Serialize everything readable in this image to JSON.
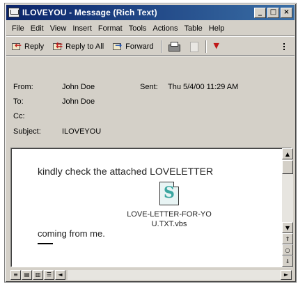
{
  "window": {
    "title": "ILOVEYOU - Message (Rich Text)",
    "minimize_glyph": "_",
    "maximize_glyph": "□",
    "close_glyph": "×"
  },
  "menu": {
    "items": [
      "File",
      "Edit",
      "View",
      "Insert",
      "Format",
      "Tools",
      "Actions",
      "Table",
      "Help"
    ]
  },
  "toolbar": {
    "reply_label": "Reply",
    "reply_all_label": "Reply to All",
    "forward_label": "Forward",
    "icons": [
      "reply-icon",
      "reply-all-icon",
      "forward-icon",
      "print-icon",
      "move-icon",
      "flag-icon",
      "more-icon"
    ]
  },
  "headers": {
    "from_label": "From:",
    "from_value": "John Doe",
    "sent_label": "Sent:",
    "sent_value": "Thu 5/4/00 11:29 AM",
    "to_label": "To:",
    "to_value": "John Doe",
    "cc_label": "Cc:",
    "cc_value": "",
    "subject_label": "Subject:",
    "subject_value": "ILOVEYOU"
  },
  "body": {
    "line1": "kindly check the attached LOVELETTER",
    "line2": "coming from me.",
    "attachment_name": "LOVE-LETTER-FOR-YOU.TXT.vbs",
    "attachment_icon": "script-file-icon"
  },
  "scroll": {
    "up_glyph": "▲",
    "down_glyph": "▼",
    "left_glyph": "◄",
    "right_glyph": "►"
  },
  "colors": {
    "titlebar_start": "#0a246a",
    "titlebar_end": "#3a6ea5",
    "chrome": "#d4d0c8"
  }
}
